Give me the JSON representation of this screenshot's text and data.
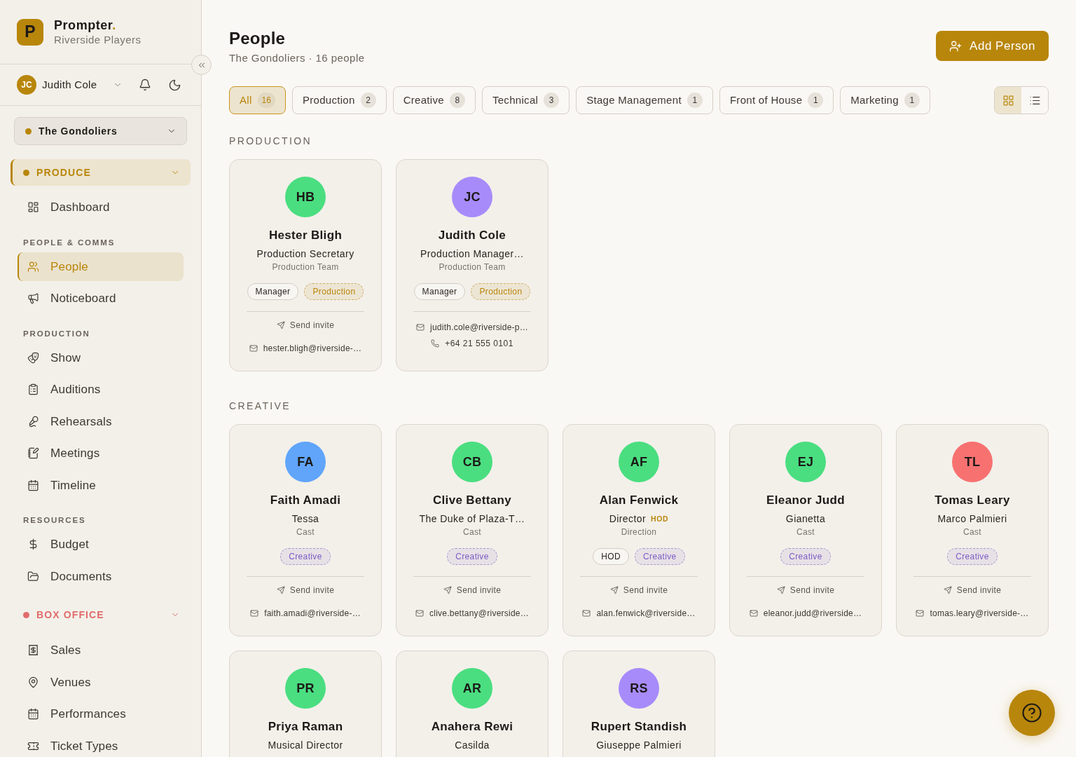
{
  "sidebar": {
    "brand": {
      "logo": "P",
      "name": "Prompter",
      "accent": ".",
      "org": "Riverside Players"
    },
    "user": {
      "initials": "JC",
      "name": "Judith Cole"
    },
    "show_selector": {
      "label": "The Gondoliers"
    },
    "groups": [
      {
        "label": "PRODUCE",
        "color": "#b8860b",
        "selected": true,
        "sections": [
          {
            "items": [
              {
                "label": "Dashboard",
                "selected": false
              }
            ]
          },
          {
            "label": "PEOPLE & COMMS",
            "items": [
              {
                "label": "People",
                "selected": true
              },
              {
                "label": "Noticeboard",
                "selected": false
              }
            ]
          },
          {
            "label": "PRODUCTION",
            "items": [
              {
                "label": "Show",
                "selected": false
              },
              {
                "label": "Auditions",
                "selected": false
              },
              {
                "label": "Rehearsals",
                "selected": false
              },
              {
                "label": "Meetings",
                "selected": false
              },
              {
                "label": "Timeline",
                "selected": false
              }
            ]
          },
          {
            "label": "RESOURCES",
            "items": [
              {
                "label": "Budget",
                "selected": false
              },
              {
                "label": "Documents",
                "selected": false
              }
            ]
          }
        ]
      },
      {
        "label": "BOX OFFICE",
        "color": "#e06c6c",
        "selected": false,
        "sections": [
          {
            "items": [
              {
                "label": "Sales",
                "selected": false
              },
              {
                "label": "Venues",
                "selected": false
              },
              {
                "label": "Performances",
                "selected": false
              },
              {
                "label": "Ticket Types",
                "selected": false
              }
            ]
          }
        ]
      }
    ]
  },
  "header": {
    "title": "People",
    "subtitle": "The Gondoliers · 16 people",
    "add_button": "Add Person"
  },
  "filters": [
    {
      "label": "All",
      "count": "16",
      "selected": true
    },
    {
      "label": "Production",
      "count": "2",
      "selected": false
    },
    {
      "label": "Creative",
      "count": "8",
      "selected": false
    },
    {
      "label": "Technical",
      "count": "3",
      "selected": false
    },
    {
      "label": "Stage Management",
      "count": "1",
      "selected": false
    },
    {
      "label": "Front of House",
      "count": "1",
      "selected": false
    },
    {
      "label": "Marketing",
      "count": "1",
      "selected": false
    }
  ],
  "view_toggle": [
    {
      "selected": true
    },
    {
      "selected": false
    }
  ],
  "sections": [
    {
      "label": "PRODUCTION",
      "people": [
        {
          "initials": "HB",
          "color": "#4ade80",
          "name": "Hester Bligh",
          "role": "Production Secretary",
          "department": "Production Team",
          "tags": [
            {
              "label": "Manager",
              "kind": "role"
            },
            {
              "label": "Production",
              "kind": "department",
              "color": "#b8860b"
            }
          ],
          "contacts": [
            {
              "kind": "invite",
              "text": "Send invite"
            },
            {
              "kind": "email",
              "text": "hester.bligh@riverside-…"
            }
          ]
        },
        {
          "initials": "JC",
          "color": "#a78bfa",
          "name": "Judith Cole",
          "role": "Production Manager…",
          "department": "Production Team",
          "tags": [
            {
              "label": "Manager",
              "kind": "role"
            },
            {
              "label": "Production",
              "kind": "department",
              "color": "#b8860b"
            }
          ],
          "contacts": [
            {
              "kind": "email",
              "text": "judith.cole@riverside-p…"
            },
            {
              "kind": "phone",
              "text": "+64 21 555 0101"
            }
          ]
        }
      ]
    },
    {
      "label": "CREATIVE",
      "people": [
        {
          "initials": "FA",
          "color": "#60a5fa",
          "name": "Faith Amadi",
          "role": "Tessa",
          "department": "Cast",
          "tags": [
            {
              "label": "Creative",
              "kind": "department",
              "color": "#7c5cc4"
            }
          ],
          "contacts": [
            {
              "kind": "invite",
              "text": "Send invite"
            },
            {
              "kind": "email",
              "text": "faith.amadi@riverside-…"
            }
          ]
        },
        {
          "initials": "CB",
          "color": "#4ade80",
          "name": "Clive Bettany",
          "role": "The Duke of Plaza-T…",
          "department": "Cast",
          "tags": [
            {
              "label": "Creative",
              "kind": "department",
              "color": "#7c5cc4"
            }
          ],
          "contacts": [
            {
              "kind": "invite",
              "text": "Send invite"
            },
            {
              "kind": "email",
              "text": "clive.bettany@riverside…"
            }
          ]
        },
        {
          "initials": "AF",
          "color": "#4ade80",
          "name": "Alan Fenwick",
          "role": "Director",
          "badge": "HOD",
          "department": "Direction",
          "tags": [
            {
              "label": "HOD",
              "kind": "role"
            },
            {
              "label": "Creative",
              "kind": "department",
              "color": "#7c5cc4"
            }
          ],
          "contacts": [
            {
              "kind": "invite",
              "text": "Send invite"
            },
            {
              "kind": "email",
              "text": "alan.fenwick@riverside…"
            }
          ]
        },
        {
          "initials": "EJ",
          "color": "#4ade80",
          "name": "Eleanor Judd",
          "role": "Gianetta",
          "department": "Cast",
          "tags": [
            {
              "label": "Creative",
              "kind": "department",
              "color": "#7c5cc4"
            }
          ],
          "contacts": [
            {
              "kind": "invite",
              "text": "Send invite"
            },
            {
              "kind": "email",
              "text": "eleanor.judd@riverside…"
            }
          ]
        },
        {
          "initials": "TL",
          "color": "#f87171",
          "name": "Tomas Leary",
          "role": "Marco Palmieri",
          "department": "Cast",
          "tags": [
            {
              "label": "Creative",
              "kind": "department",
              "color": "#7c5cc4"
            }
          ],
          "contacts": [
            {
              "kind": "invite",
              "text": "Send invite"
            },
            {
              "kind": "email",
              "text": "tomas.leary@riverside-…"
            }
          ]
        },
        {
          "initials": "PR",
          "color": "#4ade80",
          "name": "Priya Raman",
          "role": "Musical Director"
        },
        {
          "initials": "AR",
          "color": "#4ade80",
          "name": "Anahera Rewi",
          "role": "Casilda"
        },
        {
          "initials": "RS",
          "color": "#a78bfa",
          "name": "Rupert Standish",
          "role": "Giuseppe Palmieri"
        }
      ]
    }
  ]
}
